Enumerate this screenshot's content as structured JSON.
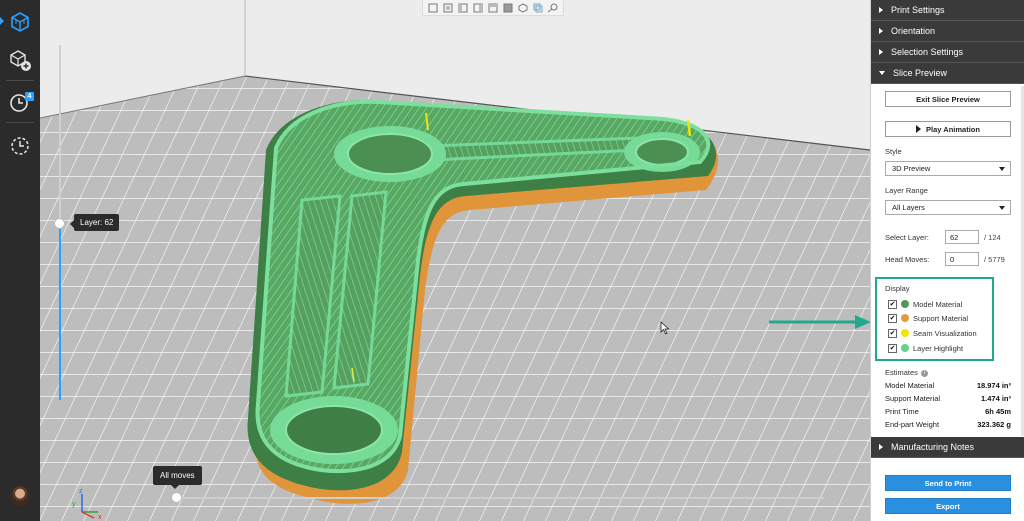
{
  "left_toolbar": {
    "items": [
      {
        "name": "3d-view-icon",
        "active": true
      },
      {
        "name": "add-part-icon"
      },
      {
        "name": "print-history-icon",
        "badge": "4"
      },
      {
        "name": "recent-history-icon"
      }
    ]
  },
  "viewport": {
    "view_buttons": [
      "front-view-icon",
      "back-view-icon",
      "left-view-icon",
      "right-view-icon",
      "top-view-icon",
      "bottom-view-icon",
      "iso-view-icon",
      "transparency-icon",
      "zoom-fit-icon"
    ],
    "layer_tooltip": "Layer: 62",
    "layer_progress": 0.5,
    "moves_tooltip": "All moves",
    "axis_labels": {
      "x": "x",
      "y": "y",
      "z": "z"
    },
    "colors": {
      "model": "#4f9a53",
      "model_highlight": "#67d08a",
      "support": "#e79a3d",
      "bed": "#b9b9b9",
      "callout": "#21a98b"
    }
  },
  "panel": {
    "sections": [
      {
        "label": "Print Settings",
        "expanded": false
      },
      {
        "label": "Orientation",
        "expanded": false
      },
      {
        "label": "Selection Settings",
        "expanded": false
      },
      {
        "label": "Slice Preview",
        "expanded": true
      }
    ],
    "exit_button": "Exit Slice Preview",
    "play_button": "Play Animation",
    "style_label": "Style",
    "style_value": "3D Preview",
    "layer_range_label": "Layer Range",
    "layer_range_value": "All Layers",
    "select_layer_label": "Select Layer:",
    "select_layer_value": "62",
    "select_layer_total": "/ 124",
    "head_moves_label": "Head Moves:",
    "head_moves_value": "0",
    "head_moves_total": "/ 5779",
    "display_label": "Display",
    "display_items": [
      {
        "label": "Model Material",
        "color": "#4f9a53",
        "checked": true
      },
      {
        "label": "Support Material",
        "color": "#e79a3d",
        "checked": true
      },
      {
        "label": "Seam Visualization",
        "color": "#f2e600",
        "checked": true
      },
      {
        "label": "Layer Highlight",
        "color": "#67d08a",
        "checked": true
      }
    ],
    "estimates_label": "Estimates",
    "estimates": [
      {
        "label": "Model Material",
        "value": "18.974 in³"
      },
      {
        "label": "Support Material",
        "value": "1.474 in³"
      },
      {
        "label": "Print Time",
        "value": "6h 45m"
      },
      {
        "label": "End-part Weight",
        "value": "323.362 g"
      }
    ],
    "manufacturing_notes": "Manufacturing Notes",
    "send_button": "Send to Print",
    "export_button": "Export"
  }
}
